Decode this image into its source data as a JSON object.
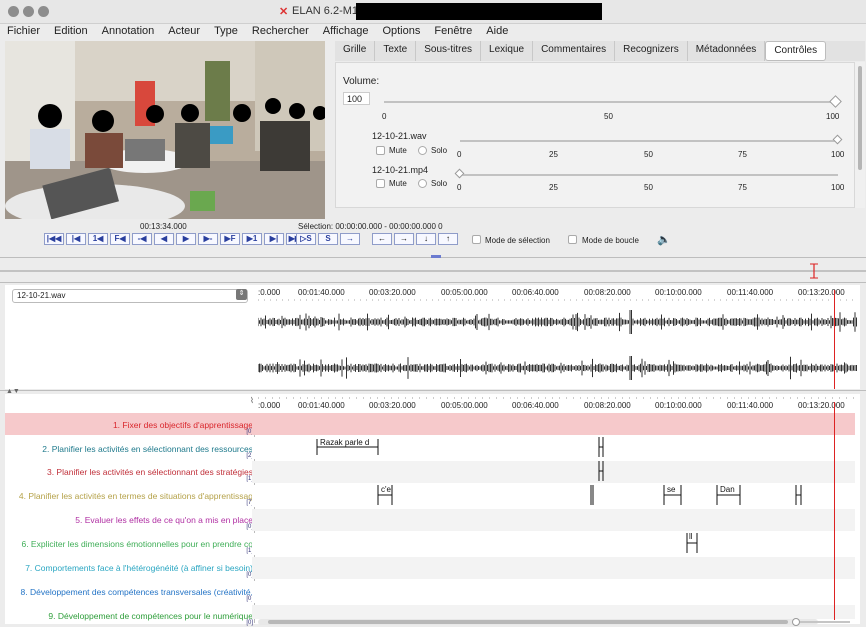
{
  "window": {
    "title": "ELAN 6.2-M1 -",
    "title_suffix_redacted": true
  },
  "menu": [
    "Fichier",
    "Edition",
    "Annotation",
    "Acteur",
    "Type",
    "Rechercher",
    "Affichage",
    "Options",
    "Fenêtre",
    "Aide"
  ],
  "tabs": [
    {
      "label": "Grille",
      "active": false
    },
    {
      "label": "Texte",
      "active": false
    },
    {
      "label": "Sous-titres",
      "active": false
    },
    {
      "label": "Lexique",
      "active": false
    },
    {
      "label": "Commentaires",
      "active": false
    },
    {
      "label": "Recognizers",
      "active": false
    },
    {
      "label": "Métadonnées",
      "active": false
    },
    {
      "label": "Contrôles",
      "active": true
    }
  ],
  "controls": {
    "volume_label": "Volume:",
    "volume_value": "100",
    "volume_ticks": [
      "0",
      "50",
      "100"
    ],
    "volume_level": 1.0,
    "tracks": [
      {
        "name": "12-10-21.wav",
        "mute_label": "Mute",
        "solo_label": "Solo",
        "ticks": [
          "0",
          "25",
          "50",
          "75",
          "100"
        ],
        "level": 1.0
      },
      {
        "name": "12-10-21.mp4",
        "mute_label": "Mute",
        "solo_label": "Solo",
        "ticks": [
          "0",
          "25",
          "50",
          "75",
          "100"
        ],
        "level": 0.0
      }
    ]
  },
  "media": {
    "current_time": "00:13:34.000",
    "selection": "Sélection: 00:00:00.000 - 00:00:00.000  0",
    "mode_selection_label": "Mode de sélection",
    "mode_boucle_label": "Mode de boucle"
  },
  "playback_buttons": [
    "|◀◀",
    "|◀",
    "1◀",
    "F◀",
    "-◀",
    "◀",
    "▶",
    "▶-",
    "▶F",
    "▶1",
    "▶|",
    "▶▶|"
  ],
  "selection_buttons": [
    "▷S",
    "S",
    "→"
  ],
  "nav_buttons": [
    "←",
    "→",
    "↓",
    "↑"
  ],
  "waveform": {
    "file_select": "12-10-21.wav",
    "ruler_labels": [
      ":0.000",
      "00:01:40.000",
      "00:03:20.000",
      "00:05:00.000",
      "00:06:40.000",
      "00:08:20.000",
      "00:10:00.000",
      "00:11:40.000",
      "00:13:20.000"
    ]
  },
  "timeline_ruler_labels": [
    ":0.000",
    "00:01:40.000",
    "00:03:20.000",
    "00:05:00.000",
    "00:06:40.000",
    "00:08:20.000",
    "00:10:00.000",
    "00:11:40.000",
    "00:13:20.000"
  ],
  "tiers": [
    {
      "name": "1. Fixer des objectifs d'apprentissage",
      "count": "[0]",
      "color": "#d9262c",
      "highlight": true
    },
    {
      "name": "2. Planifier les activités en sélectionnant des ressources",
      "count": "[2]",
      "color": "#1f7a8c",
      "highlight": false
    },
    {
      "name": "3. Planifier les activités en sélectionnant des stratégies",
      "count": "[1]",
      "color": "#c0303a",
      "highlight": false
    },
    {
      "name": "4. Planifier les activités en termes de situations d'apprentissag",
      "count": "[7]",
      "color": "#b5a24a",
      "highlight": false
    },
    {
      "name": "5. Evaluer les effets de ce qu'on a mis en place",
      "count": "[0]",
      "color": "#b02fa3",
      "highlight": false
    },
    {
      "name": "6. Expliciter les dimensions émotionnelles pour en prendre co",
      "count": "[1]",
      "color": "#3fae57",
      "highlight": false
    },
    {
      "name": "7. Comportements face à l'hétérogénéité (à affiner si besoin)",
      "count": "[0]",
      "color": "#2aa6c2",
      "highlight": false
    },
    {
      "name": "8. Développement des compétences transversales (créativité,",
      "count": "[0]",
      "color": "#2474c6",
      "highlight": false
    },
    {
      "name": "9. Développement de compétences pour le numérique",
      "count": "[0]",
      "color": "#2e9e3a",
      "highlight": false
    }
  ],
  "annotations": [
    {
      "tier": 1,
      "label": "Razak parle d"
    },
    {
      "tier": 1,
      "label": ""
    },
    {
      "tier": 2,
      "label": ""
    },
    {
      "tier": 3,
      "label": "c'e"
    },
    {
      "tier": 3,
      "label": ""
    },
    {
      "tier": 3,
      "label": "se"
    },
    {
      "tier": 3,
      "label": "Dan"
    },
    {
      "tier": 3,
      "label": ""
    },
    {
      "tier": 5,
      "label": "ll"
    }
  ],
  "colors": {
    "accent_blue": "#2a3f9e",
    "cursor_red": "#d22222",
    "tier_highlight": "#f6c9cb"
  }
}
